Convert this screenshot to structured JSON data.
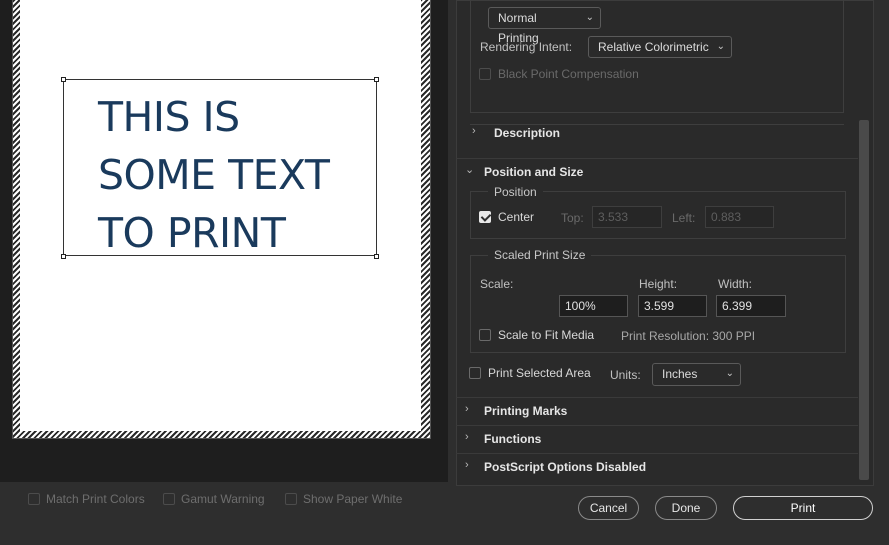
{
  "preview": {
    "text_lines": "THIS IS\nSOME TEXT\nTO PRINT"
  },
  "footer": {
    "match_print_colors": "Match Print Colors",
    "gamut_warning": "Gamut Warning",
    "show_paper_white": "Show Paper White"
  },
  "color_management": {
    "printing_mode": "Normal Printing",
    "rendering_intent_label": "Rendering Intent:",
    "rendering_intent_value": "Relative Colorimetric",
    "black_point_compensation": "Black Point Compensation"
  },
  "sections": {
    "description": "Description",
    "position_and_size": "Position and Size",
    "printing_marks": "Printing Marks",
    "functions": "Functions",
    "postscript": "PostScript Options Disabled"
  },
  "position": {
    "group_title": "Position",
    "center_label": "Center",
    "center_checked": true,
    "top_label": "Top:",
    "top_value": "3.533",
    "left_label": "Left:",
    "left_value": "0.883"
  },
  "scaled_size": {
    "group_title": "Scaled Print Size",
    "scale_label": "Scale:",
    "scale_value": "100%",
    "height_label": "Height:",
    "height_value": "3.599",
    "width_label": "Width:",
    "width_value": "6.399",
    "scale_to_fit": "Scale to Fit Media",
    "print_resolution": "Print Resolution: 300 PPI"
  },
  "selected_area": {
    "label": "Print Selected Area",
    "units_label": "Units:",
    "units_value": "Inches"
  },
  "buttons": {
    "cancel": "Cancel",
    "done": "Done",
    "print": "Print"
  }
}
